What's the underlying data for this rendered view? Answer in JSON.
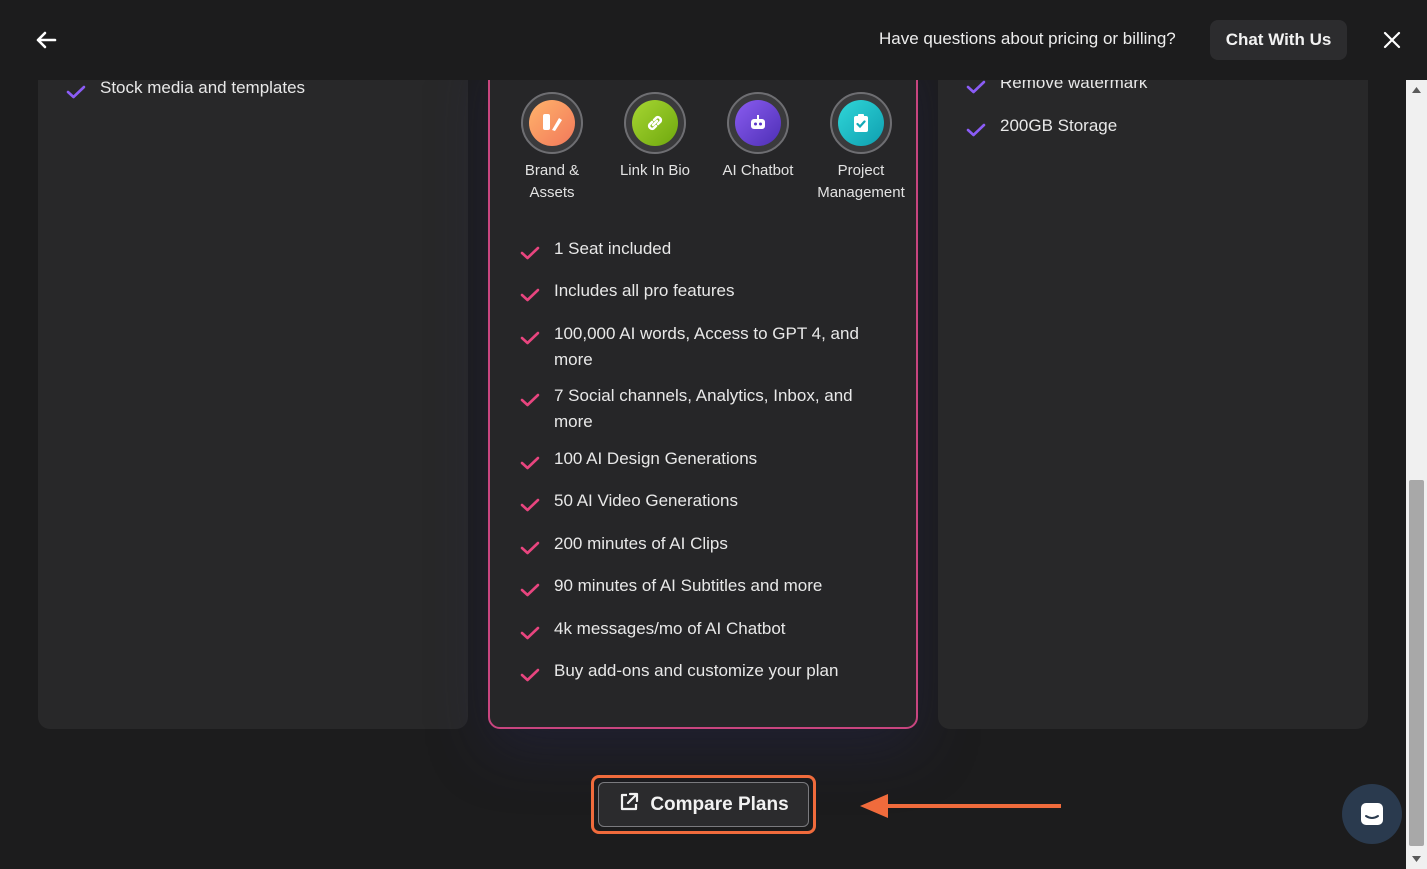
{
  "header": {
    "help_text": "Have questions about pricing or billing?",
    "chat_label": "Chat With Us"
  },
  "left_card": {
    "features": [
      "Stock media and templates"
    ]
  },
  "middle_card": {
    "addons": [
      {
        "label": "Brand & Assets",
        "icon": "brand-assets-icon",
        "color": "#f59a4a"
      },
      {
        "label": "Link In Bio",
        "icon": "link-icon",
        "color": "#8fbf1f"
      },
      {
        "label": "AI Chatbot",
        "icon": "robot-icon",
        "color": "#6a3fd6"
      },
      {
        "label": "Project Management",
        "icon": "clipboard-check-icon",
        "color": "#17b8c4"
      }
    ],
    "features": [
      "1 Seat included",
      "Includes all pro features",
      "100,000 AI words, Access to GPT 4, and more",
      "7 Social channels, Analytics, Inbox, and more",
      "100 AI Design Generations",
      "50 AI Video Generations",
      "200 minutes of AI Clips",
      "90 minutes of AI Subtitles and more",
      "4k messages/mo of AI Chatbot",
      "Buy add-ons and customize your plan"
    ],
    "check_color": "#e8457f",
    "border_color": "#c8457f"
  },
  "right_card": {
    "features": [
      "Remove watermark",
      "200GB Storage"
    ],
    "check_color": "#8b5cf6"
  },
  "compare": {
    "label": "Compare Plans",
    "highlight_color": "#f06b3c"
  }
}
